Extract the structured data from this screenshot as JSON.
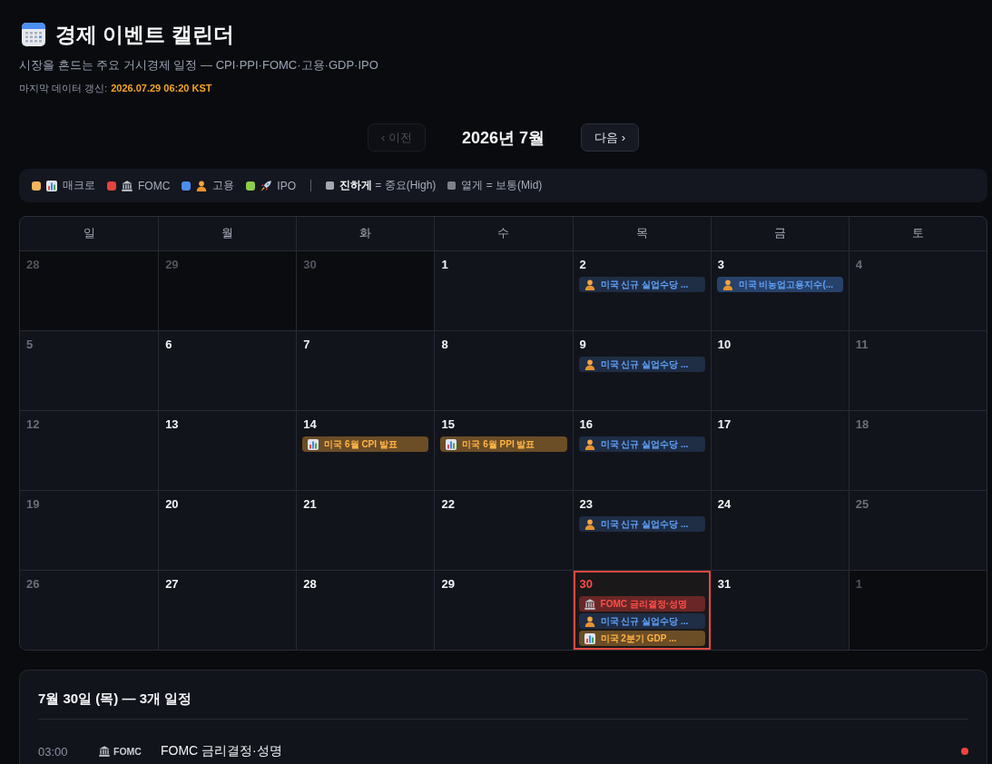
{
  "header": {
    "title": "경제 이벤트 캘린더",
    "subtitle": "시장을 흔드는 주요 거시경제 일정 — CPI·PPI·FOMC·고용·GDP·IPO",
    "updated_label": "마지막 데이터 갱신:",
    "updated_value": "2026.07.29 06:20 KST"
  },
  "nav": {
    "prev": {
      "label": "‹ 이전",
      "disabled": true
    },
    "month": "2026년 7월",
    "next": {
      "label": "다음 ›",
      "disabled": false
    }
  },
  "legend": {
    "categories": [
      {
        "kind": "macro",
        "label": "매크로",
        "color": "#f5b35a"
      },
      {
        "kind": "fomc",
        "label": "FOMC",
        "color": "#e5453c"
      },
      {
        "kind": "employment",
        "label": "고용",
        "color": "#4c8ef0"
      },
      {
        "kind": "ipo",
        "label": "IPO",
        "color": "#8fcc4a"
      }
    ],
    "importance": [
      {
        "kind": "high",
        "label": "**진하게** = 중요(High)"
      },
      {
        "kind": "mid",
        "label": "옅게 = 보통(Mid)"
      }
    ]
  },
  "calendar": {
    "weekdays": [
      "일",
      "월",
      "화",
      "수",
      "목",
      "금",
      "토"
    ],
    "weeks": [
      [
        {
          "day": "28",
          "kind": "outside",
          "selected": false
        },
        {
          "day": "29",
          "kind": "outside",
          "selected": false
        },
        {
          "day": "30",
          "kind": "outside",
          "selected": false
        },
        {
          "day": "1",
          "kind": "weekday",
          "selected": false
        },
        {
          "day": "2",
          "kind": "weekday",
          "selected": false,
          "events": [
            {
              "kind": "employment",
              "high_importance": false,
              "title": "미국 신규 실업수당 ..."
            }
          ]
        },
        {
          "day": "3",
          "kind": "weekday",
          "selected": false,
          "events": [
            {
              "kind": "employment",
              "high_importance": true,
              "title": "미국 비농업고용지수(..."
            }
          ]
        },
        {
          "day": "4",
          "kind": "weekend",
          "selected": false
        }
      ],
      [
        {
          "day": "5",
          "kind": "weekend",
          "selected": false
        },
        {
          "day": "6",
          "kind": "weekday",
          "selected": false
        },
        {
          "day": "7",
          "kind": "weekday",
          "selected": false
        },
        {
          "day": "8",
          "kind": "weekday",
          "selected": false
        },
        {
          "day": "9",
          "kind": "weekday",
          "selected": false,
          "events": [
            {
              "kind": "employment",
              "high_importance": false,
              "title": "미국 신규 실업수당 ..."
            }
          ]
        },
        {
          "day": "10",
          "kind": "weekday",
          "selected": false
        },
        {
          "day": "11",
          "kind": "weekend",
          "selected": false
        }
      ],
      [
        {
          "day": "12",
          "kind": "weekend",
          "selected": false
        },
        {
          "day": "13",
          "kind": "weekday",
          "selected": false
        },
        {
          "day": "14",
          "kind": "weekday",
          "selected": false,
          "events": [
            {
              "kind": "macro",
              "high_importance": true,
              "title": "미국 6월 CPI 발표"
            }
          ]
        },
        {
          "day": "15",
          "kind": "weekday",
          "selected": false,
          "events": [
            {
              "kind": "macro",
              "high_importance": true,
              "title": "미국 6월 PPI 발표"
            }
          ]
        },
        {
          "day": "16",
          "kind": "weekday",
          "selected": false,
          "events": [
            {
              "kind": "employment",
              "high_importance": false,
              "title": "미국 신규 실업수당 ..."
            }
          ]
        },
        {
          "day": "17",
          "kind": "weekday",
          "selected": false
        },
        {
          "day": "18",
          "kind": "weekend",
          "selected": false
        }
      ],
      [
        {
          "day": "19",
          "kind": "weekend",
          "selected": false
        },
        {
          "day": "20",
          "kind": "weekday",
          "selected": false
        },
        {
          "day": "21",
          "kind": "weekday",
          "selected": false
        },
        {
          "day": "22",
          "kind": "weekday",
          "selected": false
        },
        {
          "day": "23",
          "kind": "weekday",
          "selected": false,
          "events": [
            {
              "kind": "employment",
              "high_importance": false,
              "title": "미국 신규 실업수당 ..."
            }
          ]
        },
        {
          "day": "24",
          "kind": "weekday",
          "selected": false
        },
        {
          "day": "25",
          "kind": "weekend",
          "selected": false
        }
      ],
      [
        {
          "day": "26",
          "kind": "weekend",
          "selected": false
        },
        {
          "day": "27",
          "kind": "weekday",
          "selected": false
        },
        {
          "day": "28",
          "kind": "weekday",
          "selected": false
        },
        {
          "day": "29",
          "kind": "weekday",
          "selected": false
        },
        {
          "day": "30",
          "kind": "weekday",
          "selected": true,
          "events": [
            {
              "kind": "fomc",
              "high_importance": true,
              "title": "FOMC 금리결정·성명"
            },
            {
              "kind": "employment",
              "high_importance": false,
              "title": "미국 신규 실업수당 ..."
            },
            {
              "kind": "macro",
              "high_importance": true,
              "title": "미국 2분기 GDP ..."
            }
          ]
        },
        {
          "day": "31",
          "kind": "weekday",
          "selected": false
        },
        {
          "day": "1",
          "kind": "outside",
          "selected": false
        }
      ]
    ]
  },
  "detail": {
    "title": "7월 30일 (목) — 3개 일정",
    "events": [
      {
        "time": "03:00",
        "kind": "fomc",
        "tag": "FOMC",
        "title": "FOMC 금리결정·성명",
        "high_importance": true
      }
    ]
  }
}
